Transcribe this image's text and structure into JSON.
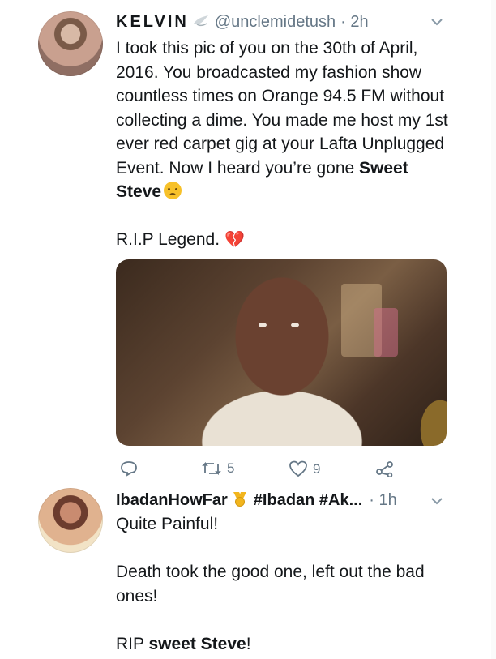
{
  "tweets": [
    {
      "name": "KELVIN",
      "handle": "@unclemidetush",
      "time": "· 2h",
      "paragraphs": [
        "I took this pic of you on the 30th of April, 2016. You broadcasted my fashion show countless times on Orange 94.5 FM without collecting a dime. You made me host my 1st ever red carpet gig at your Lafta Unplugged Event. Now I heard you’re gone ",
        "Sweet Steve",
        "R.I.P Legend."
      ],
      "emojis": [
        "bird-emoji",
        "worried-face-emoji",
        "broken-heart-emoji"
      ],
      "replies": "",
      "retweets": "5",
      "likes": "9"
    },
    {
      "name": "IbadanHowFar",
      "hashtags": "#Ibadan #Ak...",
      "time": "· 1h",
      "line1": "Quite Painful!",
      "line2": "Death took the good one, left out the bad ones!",
      "line3_prefix": "RIP ",
      "line3_bold": "sweet Steve",
      "line3_suffix": "!"
    }
  ],
  "icons": [
    "reply-icon",
    "retweet-icon",
    "like-icon",
    "share-icon",
    "chevron-down-icon",
    "medal-emoji"
  ],
  "colors": {
    "text": "#14171a",
    "secondary": "#657786",
    "broken_heart": "#e0506e"
  }
}
